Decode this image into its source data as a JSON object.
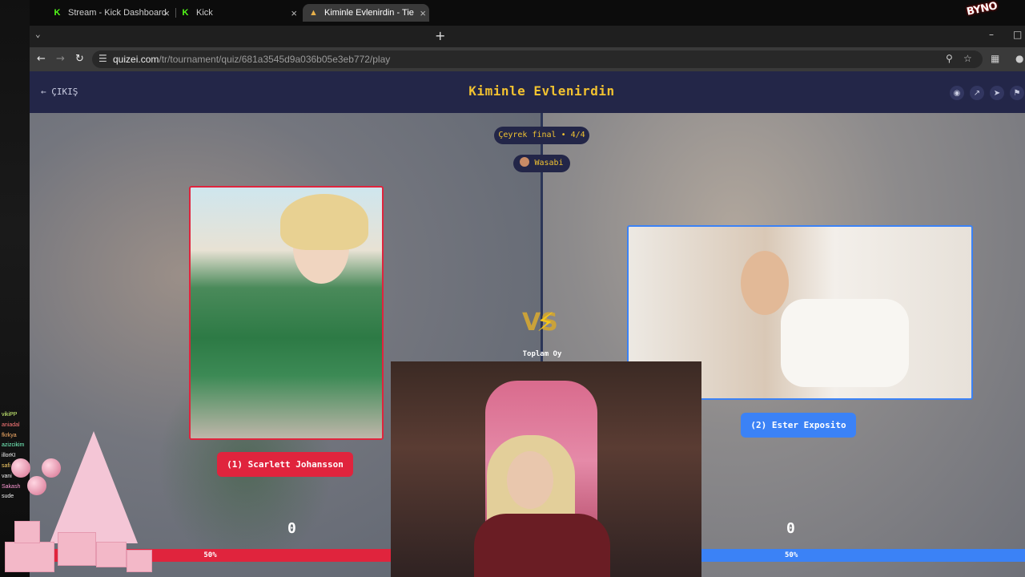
{
  "stream_overlay": {
    "logo": "BYNO"
  },
  "browser": {
    "tabs": [
      {
        "title": "Stream - Kick Dashboard",
        "active": false
      },
      {
        "title": "Kick",
        "active": false
      },
      {
        "title": "Kiminle Evlenirdin - Tier List, Kö",
        "active": true
      }
    ],
    "url_host": "quizei.com",
    "url_path": "/tr/tournament/quiz/681a3545d9a036b05e3eb772/play"
  },
  "page": {
    "exit_label": "ÇIKIŞ",
    "title": "Kiminle Evlenirdin",
    "round": "Çeyrek final • 4/4",
    "creator": "Wasabi",
    "vs_label": "VS",
    "total_votes_label": "Toplam Oy",
    "left": {
      "name": "(1) Scarlett Johansson",
      "votes": "0",
      "percent": "50%",
      "color": "#e0243d"
    },
    "right": {
      "name": "(2) Ester Exposito",
      "votes": "0",
      "percent": "50%",
      "color": "#3b82f6"
    }
  },
  "chat": {
    "lines": [
      "vikiPP",
      "aniadal",
      "fkrkya",
      "azizcikim",
      "illorKI",
      "safi",
      "vani",
      "Sakash",
      "sude"
    ]
  },
  "colors": {
    "accent": "#f2c230",
    "header_bg": "#232648",
    "left": "#e0243d",
    "right": "#3b82f6"
  }
}
